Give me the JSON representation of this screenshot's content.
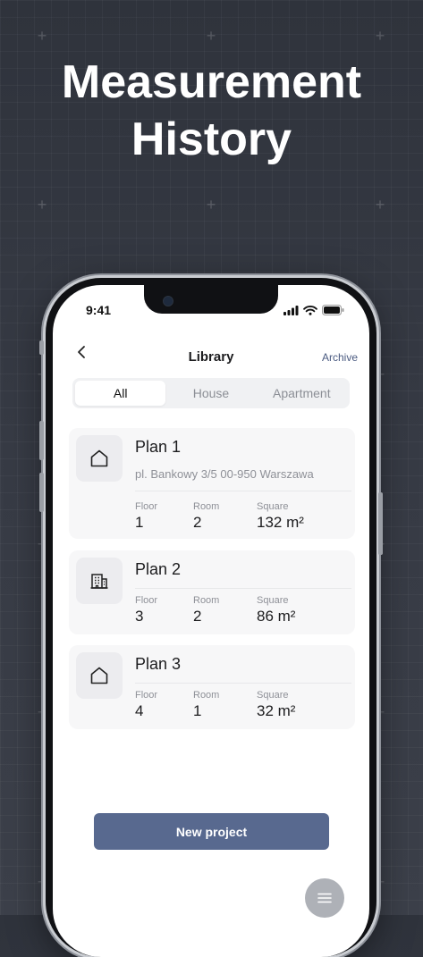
{
  "hero": {
    "line1": "Measurement",
    "line2": "History"
  },
  "status_bar": {
    "time": "9:41"
  },
  "nav": {
    "back_icon": "chevron-left-icon",
    "title": "Library",
    "archive": "Archive"
  },
  "tabs": [
    {
      "label": "All",
      "active": true
    },
    {
      "label": "House",
      "active": false
    },
    {
      "label": "Apartment",
      "active": false
    }
  ],
  "plans": [
    {
      "title": "Plan 1",
      "address": "pl. Bankowy 3/5 00-950 Warszawa",
      "icon": "house-icon",
      "metrics": [
        {
          "label": "Floor",
          "value": "1"
        },
        {
          "label": "Room",
          "value": "2"
        },
        {
          "label": "Square",
          "value": "132 m²"
        }
      ]
    },
    {
      "title": "Plan 2",
      "icon": "building-icon",
      "metrics": [
        {
          "label": "Floor",
          "value": "3"
        },
        {
          "label": "Room",
          "value": "2"
        },
        {
          "label": "Square",
          "value": "86 m²"
        }
      ]
    },
    {
      "title": "Plan 3",
      "icon": "house-icon",
      "metrics": [
        {
          "label": "Floor",
          "value": "4"
        },
        {
          "label": "Room",
          "value": "1"
        },
        {
          "label": "Square",
          "value": "32 m²"
        }
      ]
    }
  ],
  "actions": {
    "new_project": "New project",
    "menu_icon": "menu-icon"
  },
  "colors": {
    "accent": "#58698f",
    "background": "#363a43"
  }
}
